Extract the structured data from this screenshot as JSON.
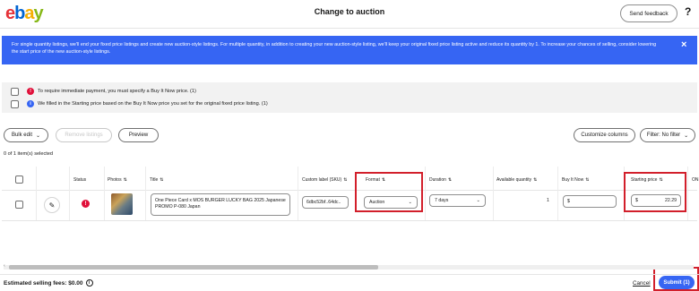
{
  "header": {
    "logo_letters": [
      "e",
      "b",
      "a",
      "y"
    ],
    "title": "Change to auction",
    "send_feedback_label": "Send feedback",
    "help_label": "?"
  },
  "banner": {
    "text": "For single quantity listings, we'll end your fixed price listings and create new auction-style listings. For multiple quantity, in addition to creating your new auction-style listing, we'll keep your original fixed price listing active and reduce its quantity by 1. To increase your chances of selling, consider lowering the start price of the new auction-style listings.",
    "close_icon": "×",
    "color": "#3665f3"
  },
  "notices": [
    {
      "icon": "!",
      "icon_color": "#e0103a",
      "text": "To require immediate payment, you must specify a Buy It Now price. (1)"
    },
    {
      "icon": "i",
      "icon_color": "#3665f3",
      "text": "We filled in the Starting price based on the Buy It Now price you set for the original fixed price listing. (1)"
    }
  ],
  "toolbar": {
    "bulk_edit_label": "Bulk edit",
    "remove_listings_label": "Remove listings",
    "preview_label": "Preview",
    "customize_columns_label": "Customize columns",
    "filter_label": "Filter: No filter",
    "selected_count": "0 of 1 item(s) selected"
  },
  "table": {
    "columns": {
      "status": "Status",
      "photos": "Photos",
      "title": "Title",
      "custom_label": "Custom label (SKU)",
      "format": "Format",
      "duration": "Duration",
      "available_quantity": "Available quantity",
      "buy_it_now": "Buy It Now",
      "starting_price": "Starting price",
      "overflow": "ON"
    },
    "sort_icon": "⇅",
    "row": {
      "title": "One Piece Card x MOS BURGER LUCKY BAG 2025 Japanese PROMO P-080 Japan",
      "sku": "6dbc52bf..64dc..",
      "format": "Auction",
      "duration": "7 days",
      "available_quantity": "1",
      "buy_it_now": "$",
      "starting_price_currency": "$",
      "starting_price": "22.29"
    }
  },
  "footer": {
    "fees_label": "Estimated selling fees: $0.00",
    "info_icon": "i",
    "cancel_label": "Cancel",
    "submit_label": "Submit (1)"
  }
}
